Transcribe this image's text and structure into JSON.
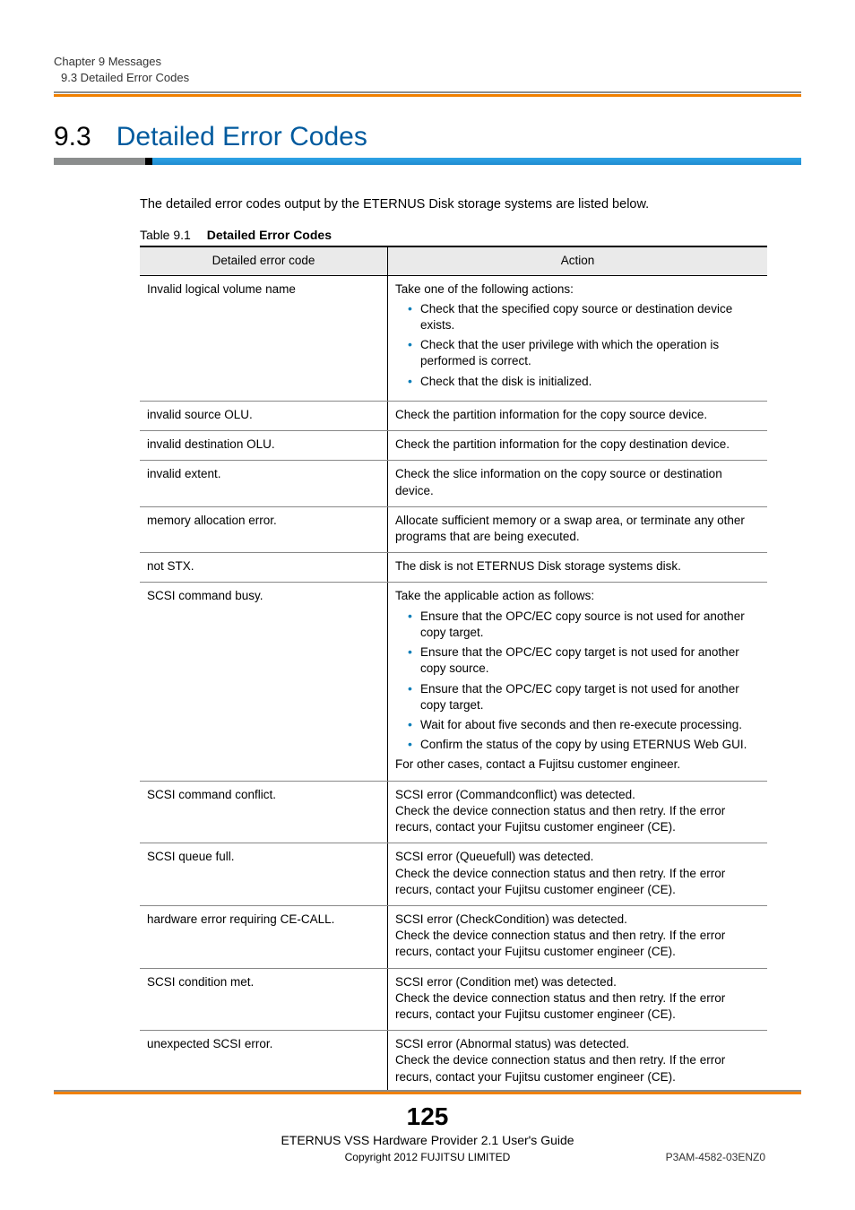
{
  "header": {
    "chapter_line": "Chapter 9  Messages",
    "section_line": "9.3  Detailed Error Codes"
  },
  "heading": {
    "number": "9.3",
    "title": "Detailed Error Codes"
  },
  "intro": "The detailed error codes output by the ETERNUS Disk storage systems are listed below.",
  "table_caption": {
    "label": "Table 9.1",
    "title": "Detailed Error Codes"
  },
  "table": {
    "columns": [
      "Detailed error code",
      "Action"
    ],
    "rows": [
      {
        "code": "Invalid logical volume name",
        "action_lead": "Take one of the following actions:",
        "action_bullets": [
          "Check that the specified copy source or destination device exists.",
          "Check that the user privilege with which the operation is performed is correct.",
          "Check that the disk is initialized."
        ]
      },
      {
        "code": "invalid source OLU.",
        "action_text": "Check the partition information for the copy source device."
      },
      {
        "code": "invalid destination OLU.",
        "action_text": "Check the partition information for the copy destination device."
      },
      {
        "code": "invalid extent.",
        "action_text": "Check the slice information on the copy source or destination device."
      },
      {
        "code": "memory allocation error.",
        "action_text": "Allocate sufficient memory or a swap area, or terminate any other programs that are being executed."
      },
      {
        "code": "not STX.",
        "action_text": "The disk is not ETERNUS Disk storage systems disk."
      },
      {
        "code": "SCSI command busy.",
        "action_lead": "Take the applicable action as follows:",
        "action_bullets": [
          "Ensure that the OPC/EC copy source is not used for another copy target.",
          "Ensure that the OPC/EC copy target is not used for another copy source.",
          "Ensure that the OPC/EC copy target is not used for another copy target.",
          "Wait for about five seconds and then re-execute processing.",
          "Confirm the status of the copy by using ETERNUS Web GUI."
        ],
        "action_foot": "For other cases, contact a Fujitsu customer engineer."
      },
      {
        "code": "SCSI command conflict.",
        "action_text": "SCSI error (Commandconflict) was detected.\nCheck the device connection status and then retry. If the error recurs, contact your Fujitsu customer engineer (CE)."
      },
      {
        "code": "SCSI queue full.",
        "action_text": "SCSI error (Queuefull) was detected.\nCheck the device connection status and then retry. If the error recurs, contact your Fujitsu customer engineer (CE)."
      },
      {
        "code": "hardware error requiring CE-CALL.",
        "action_text": "SCSI error (CheckCondition) was detected.\nCheck the device connection status and then retry. If the error recurs, contact your Fujitsu customer engineer (CE)."
      },
      {
        "code": "SCSI condition met.",
        "action_text": "SCSI error (Condition met) was detected.\nCheck the device connection status and then retry. If the error recurs, contact your Fujitsu customer engineer (CE)."
      },
      {
        "code": "unexpected SCSI error.",
        "action_text": "SCSI error (Abnormal status) was detected.\nCheck the device connection status and then retry. If the error recurs, contact your Fujitsu customer engineer (CE)."
      }
    ]
  },
  "footer": {
    "page_number": "125",
    "doc_title": "ETERNUS VSS Hardware Provider 2.1 User's Guide",
    "copyright": "Copyright 2012 FUJITSU LIMITED",
    "doc_code": "P3AM-4582-03ENZ0"
  }
}
